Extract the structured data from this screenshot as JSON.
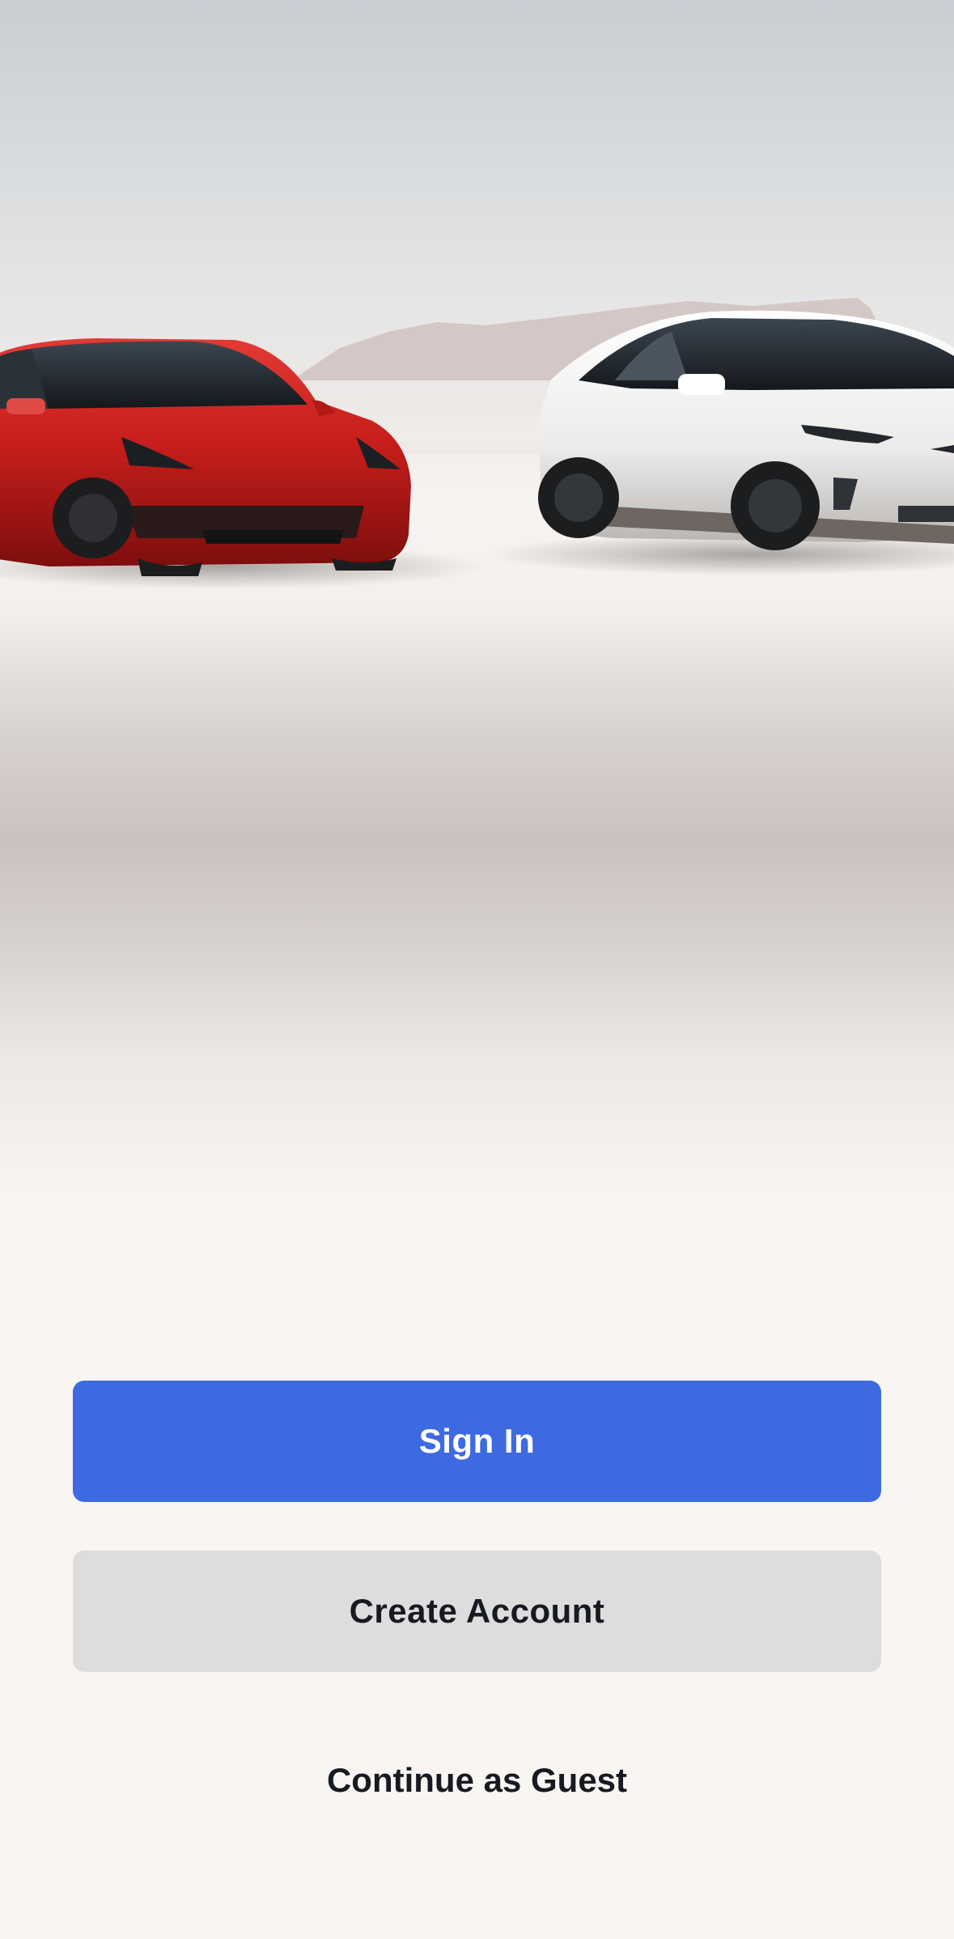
{
  "actions": {
    "sign_in_label": "Sign In",
    "create_account_label": "Create Account",
    "guest_label": "Continue as Guest"
  },
  "colors": {
    "primary": "#3e6ae1",
    "secondary": "#dddddd",
    "text": "#171a20",
    "background": "#f8f5f2"
  }
}
